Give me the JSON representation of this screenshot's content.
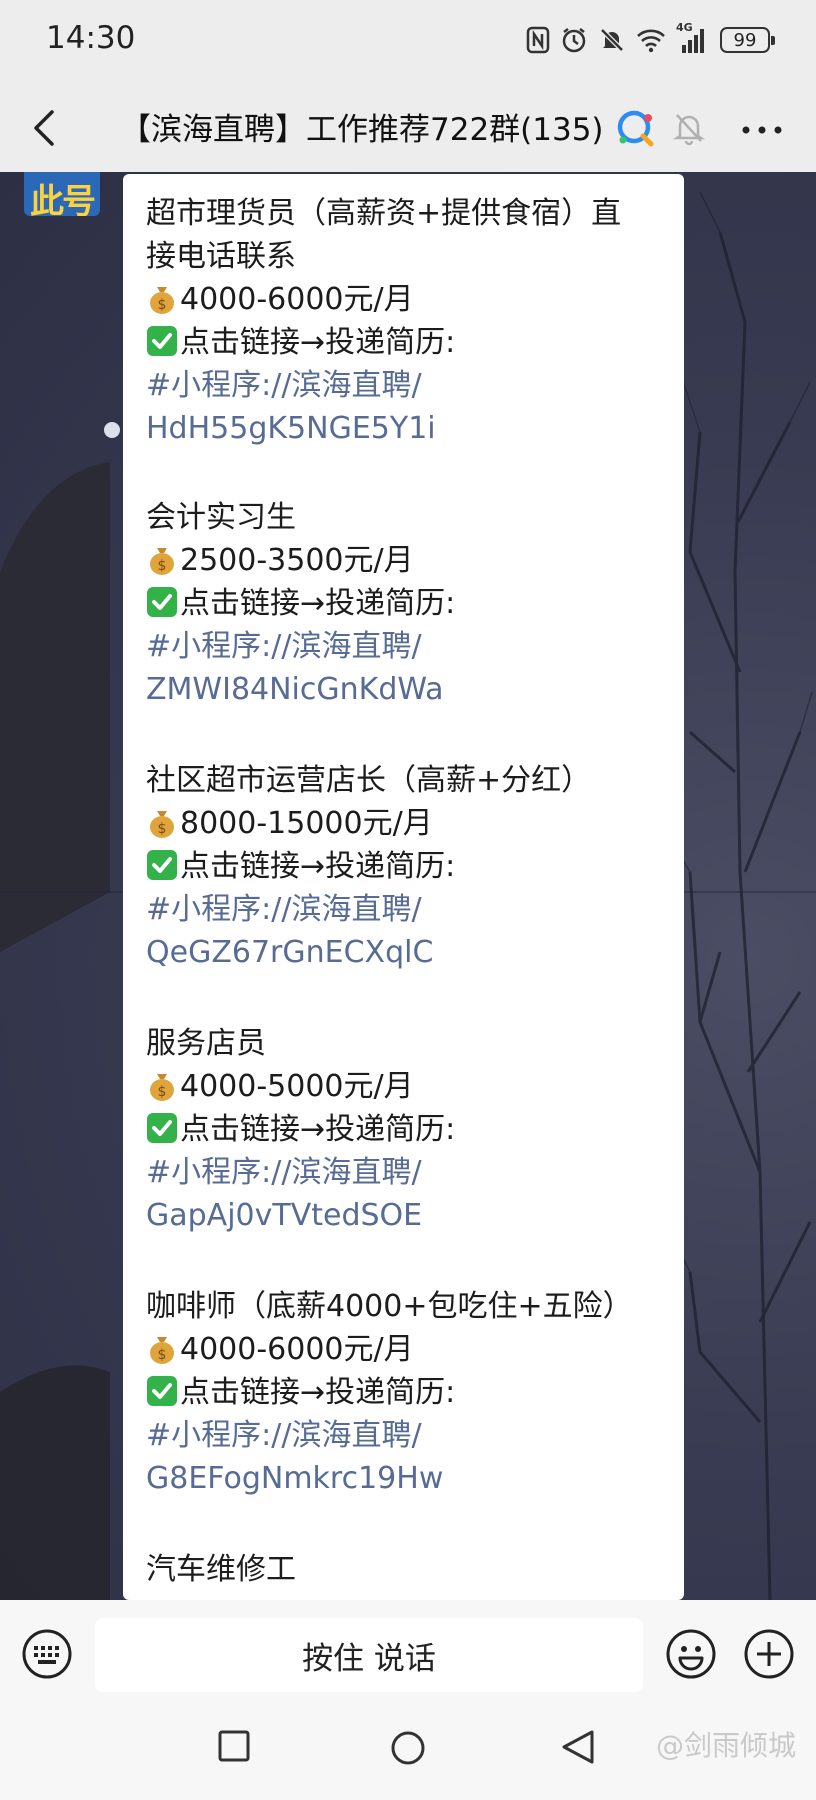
{
  "status_bar": {
    "time": "14:30",
    "network": "4G",
    "battery": "99",
    "icons": [
      "nfc-icon",
      "alarm-icon",
      "mute-icon",
      "wifi-icon",
      "signal-icon",
      "battery-icon"
    ]
  },
  "header": {
    "title": "【滨海直聘】工作推荐722群(135)",
    "icons": [
      "back-arrow-icon",
      "qq-channel-icon",
      "bell-muted-icon",
      "more-icon"
    ]
  },
  "avatar": {
    "text": "此号"
  },
  "message": {
    "jobs": [
      {
        "title_lines": [
          "超市理货员（高薪资+提供食宿）直",
          "接电话联系"
        ],
        "salary": "4000-6000元/月",
        "action": "点击链接→投递简历:",
        "link_prefix": "#小程序://滨海直聘/",
        "link_code": "HdH55gK5NGE5Y1i"
      },
      {
        "title_lines": [
          "会计实习生"
        ],
        "salary": "2500-3500元/月",
        "action": "点击链接→投递简历:",
        "link_prefix": "#小程序://滨海直聘/",
        "link_code": "ZMWI84NicGnKdWa"
      },
      {
        "title_lines": [
          "社区超市运营店长（高薪+分红）"
        ],
        "salary": "8000-15000元/月",
        "action": "点击链接→投递简历:",
        "link_prefix": "#小程序://滨海直聘/",
        "link_code": "QeGZ67rGnECXqlC"
      },
      {
        "title_lines": [
          "服务店员"
        ],
        "salary": "4000-5000元/月",
        "action": "点击链接→投递简历:",
        "link_prefix": "#小程序://滨海直聘/",
        "link_code": "GapAj0vTVtedSOE"
      },
      {
        "title_lines": [
          "咖啡师（底薪4000+包吃住+五险）"
        ],
        "salary": "4000-6000元/月",
        "action": "点击链接→投递简历:",
        "link_prefix": "#小程序://滨海直聘/",
        "link_code": "G8EFogNmkrc19Hw"
      },
      {
        "title_lines": [
          "汽车维修工"
        ]
      }
    ]
  },
  "input_bar": {
    "voice_label": "按住 说话",
    "icons": [
      "keyboard-icon",
      "emoji-icon",
      "plus-icon"
    ]
  },
  "nav_bar": {
    "icons": [
      "recent-apps-icon",
      "home-icon",
      "back-icon"
    ],
    "watermark": "@剑雨倾城"
  },
  "colors": {
    "link": "#576b95",
    "header_bg": "#ededed",
    "avatar_bg": "#2c68b8",
    "avatar_text": "#ffd13a"
  }
}
